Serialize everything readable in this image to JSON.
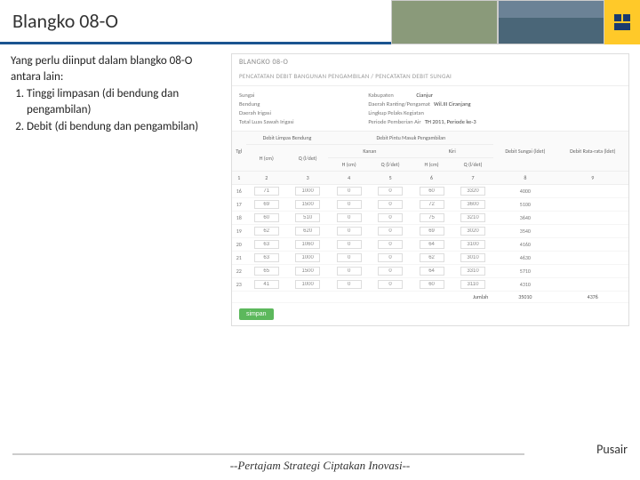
{
  "slide": {
    "title": "Blangko 08-O",
    "intro": "Yang perlu diinput dalam blangko 08-O antara lain:",
    "items": [
      "Tinggi limpasan (di bendung dan pengambilan)",
      "Debit (di bendung dan pengambilan)"
    ]
  },
  "app": {
    "title": "BLANGKO 08-O",
    "subtitle": "PENCATATAN DEBIT BANGUNAN PENGAMBILAN / PENCATATAN DEBIT SUNGAI",
    "info": {
      "sungai_l": "Sungai",
      "sungai_v": "",
      "bendung_l": "Bendung",
      "bendung_v": "",
      "daerah_l": "Daerah Irigasi",
      "daerah_v": "",
      "luas_l": "Total Luas Sawah Irigasi",
      "luas_v": "",
      "kab_l": "Kabupaten",
      "kab_v": "Cianjur",
      "ranting_l": "Daerah Ranting/Pengamat",
      "ranting_v": "Wil.III Ciranjang",
      "lingkup_l": "Lingkup Pelaks Kegiatan",
      "lingkup_v": "",
      "periode_l": "Periode Pemberian Air",
      "periode_v": "TH 2011, Periode ke-3"
    },
    "headers": {
      "tgl": "Tgl",
      "limpas": "Debit Limpas Bendung",
      "pintu": "Debit Pintu Masuk Pengambilan",
      "kanan": "Kanan",
      "kiri": "Kiri",
      "hcm": "H (cm)",
      "qldet": "Q (l/det)",
      "sungai": "Debit Sungai (ldet)",
      "rata": "Debit Rata-rata (ldet)"
    },
    "cols": [
      "1",
      "2",
      "3",
      "4",
      "5",
      "6",
      "7",
      "8",
      "9"
    ],
    "rows": [
      {
        "tgl": "16",
        "h1": "71",
        "q1": "1000",
        "h2": "0",
        "q2": "0",
        "h3": "60",
        "q3": "3320",
        "sungai": "4000",
        "rata": ""
      },
      {
        "tgl": "17",
        "h1": "69",
        "q1": "1500",
        "h2": "0",
        "q2": "0",
        "h3": "72",
        "q3": "3600",
        "sungai": "5100",
        "rata": ""
      },
      {
        "tgl": "18",
        "h1": "60",
        "q1": "510",
        "h2": "0",
        "q2": "0",
        "h3": "75",
        "q3": "3210",
        "sungai": "3640",
        "rata": ""
      },
      {
        "tgl": "19",
        "h1": "62",
        "q1": "620",
        "h2": "0",
        "q2": "0",
        "h3": "69",
        "q3": "3020",
        "sungai": "3540",
        "rata": ""
      },
      {
        "tgl": "20",
        "h1": "63",
        "q1": "1060",
        "h2": "0",
        "q2": "0",
        "h3": "64",
        "q3": "3100",
        "sungai": "4160",
        "rata": ""
      },
      {
        "tgl": "21",
        "h1": "63",
        "q1": "1000",
        "h2": "0",
        "q2": "0",
        "h3": "62",
        "q3": "3010",
        "sungai": "4630",
        "rata": ""
      },
      {
        "tgl": "22",
        "h1": "65",
        "q1": "1500",
        "h2": "0",
        "q2": "0",
        "h3": "64",
        "q3": "3310",
        "sungai": "5710",
        "rata": ""
      },
      {
        "tgl": "23",
        "h1": "41",
        "q1": "1000",
        "h2": "0",
        "q2": "0",
        "h3": "60",
        "q3": "3110",
        "sungai": "4310",
        "rata": ""
      }
    ],
    "jumlah_l": "Jumlah",
    "jumlah_v": "35010",
    "rata_v": "4376",
    "save": "simpan"
  },
  "footer": {
    "right": "Pusair",
    "center": "--Pertajam Strategi Ciptakan Inovasi--"
  }
}
